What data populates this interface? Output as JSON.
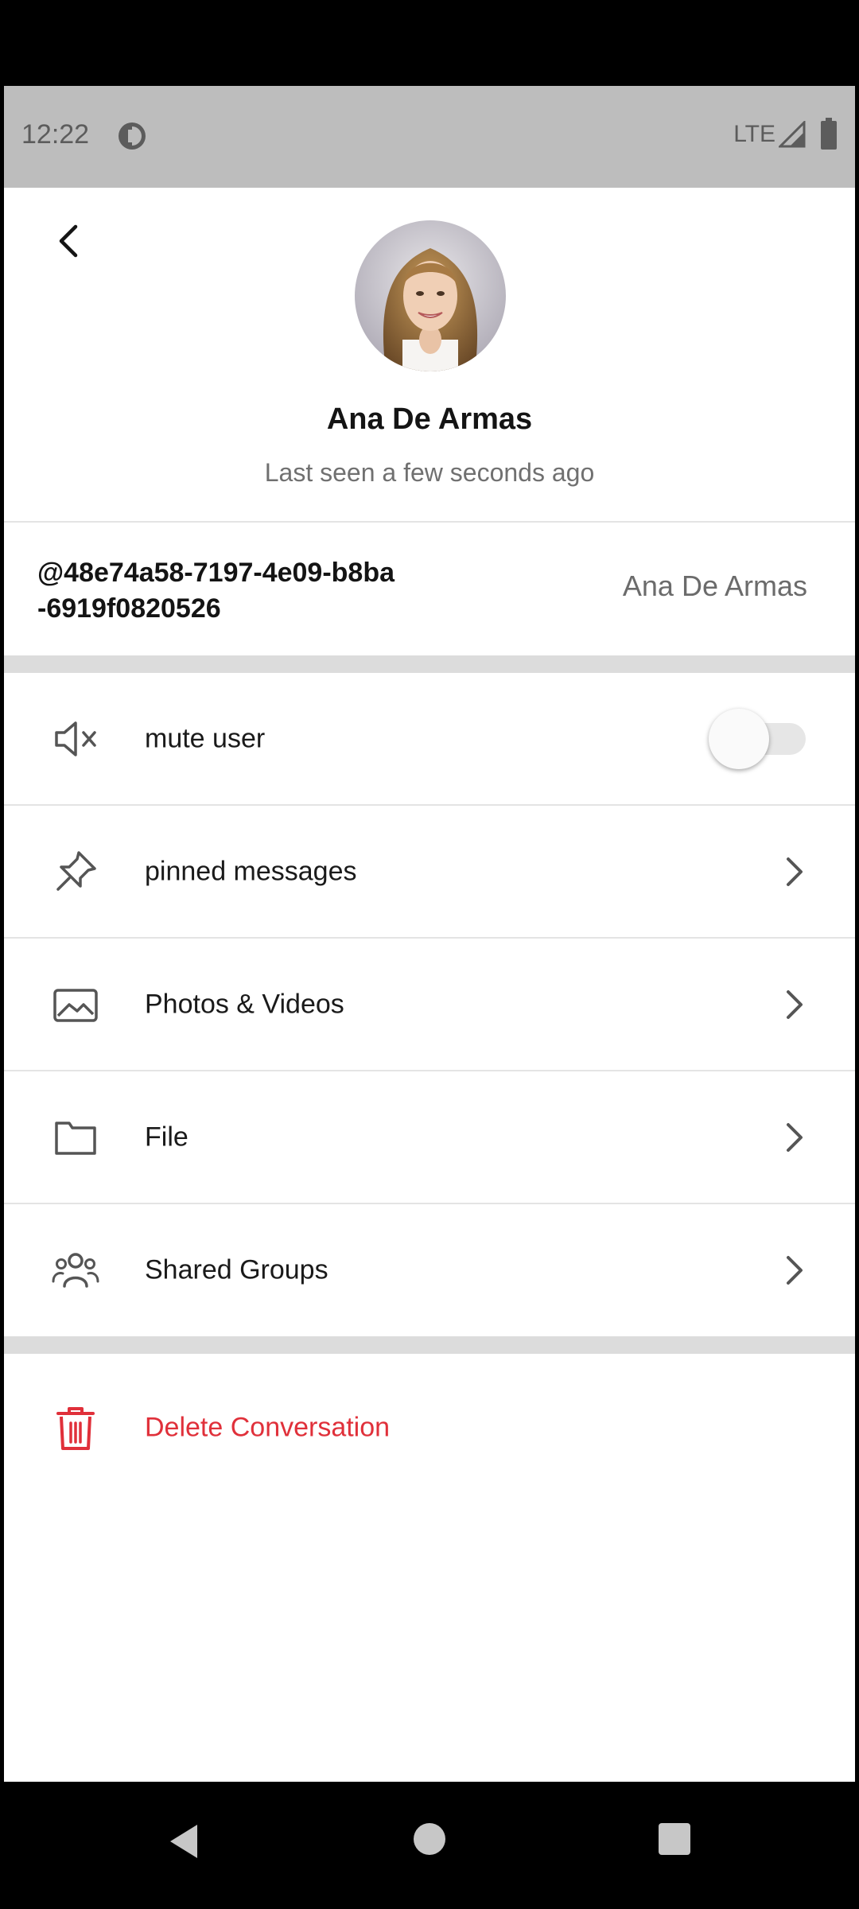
{
  "status_bar": {
    "time": "12:22",
    "network": "LTE",
    "icons": [
      "app-notification-icon",
      "signal-icon",
      "battery-icon"
    ]
  },
  "header": {
    "back_icon": "back-arrow-icon",
    "avatar": "contact-photo",
    "name": "Ana De Armas",
    "last_seen": "Last seen a few seconds ago"
  },
  "identity": {
    "user_id_line1": "@48e74a58-7197-4e09-b8ba",
    "user_id_line2": "-6919f0820526",
    "display_name": "Ana De Armas"
  },
  "menu": {
    "mute": {
      "label": "mute user",
      "icon": "speaker-mute-icon",
      "toggle_on": false
    },
    "items": [
      {
        "label": "pinned messages",
        "icon": "pin-icon"
      },
      {
        "label": "Photos & Videos",
        "icon": "image-icon"
      },
      {
        "label": "File",
        "icon": "folder-icon"
      },
      {
        "label": "Shared Groups",
        "icon": "group-icon"
      }
    ],
    "delete": {
      "label": "Delete Conversation",
      "icon": "trash-icon"
    }
  },
  "colors": {
    "danger": "#e0303a",
    "status_bar_bg": "#bdbdbd",
    "section_gap": "#dcdcdc",
    "toggle_track": "#e6e6e6"
  }
}
